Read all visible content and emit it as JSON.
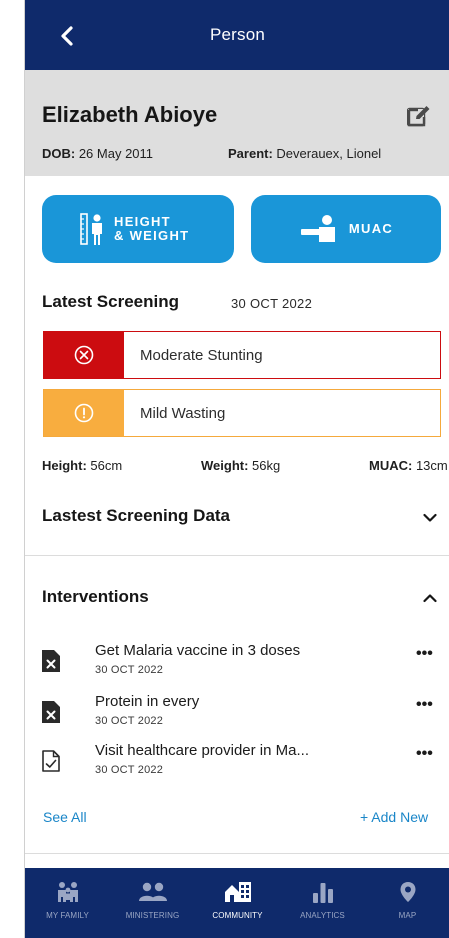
{
  "header": {
    "title": "Person",
    "back_icon": "chevron-left-icon"
  },
  "person": {
    "name": "Elizabeth Abioye",
    "dob_label": "DOB:",
    "dob_value": " 26 May 2011",
    "parent_label": "Parent:",
    "parent_value": " Deverauex, Lionel",
    "edit_icon": "edit-icon"
  },
  "actions": {
    "height_weight_line1": "HEIGHT",
    "height_weight_line2": "& WEIGHT",
    "muac_label": "MUAC"
  },
  "latest_screening": {
    "title": "Latest Screening",
    "date": "30 OCT 2022",
    "statuses": [
      {
        "label": "Moderate Stunting",
        "color": "#cc0c10",
        "icon": "x-circle-icon"
      },
      {
        "label": "Mild Wasting",
        "color": "#f8ad3f",
        "icon": "alert-circle-icon"
      }
    ],
    "height_label": "Height:",
    "height_value": " 56cm",
    "weight_label": "Weight:",
    "weight_value": " 56kg",
    "muac_label": "MUAC:",
    "muac_value": " 13cm"
  },
  "screening_data": {
    "title": "Lastest Screening Data"
  },
  "interventions": {
    "title": "Interventions",
    "items": [
      {
        "title": "Get Malaria vaccine in 3 doses",
        "date": "30 OCT 2022",
        "icon": "file-x-icon"
      },
      {
        "title": "Protein in every",
        "date": "30 OCT 2022",
        "icon": "file-x-icon"
      },
      {
        "title": "Visit healthcare provider in Ma...",
        "date": "30 OCT 2022",
        "icon": "file-check-icon"
      }
    ],
    "more_label": "•••",
    "see_all": "See All",
    "add_new": "+ Add New"
  },
  "nav": {
    "items": [
      {
        "label": "MY FAMILY",
        "icon": "family-icon"
      },
      {
        "label": "MINISTERING",
        "icon": "people-icon"
      },
      {
        "label": "COMMUNITY",
        "icon": "community-icon",
        "active": true
      },
      {
        "label": "ANALYTICS",
        "icon": "bar-chart-icon"
      },
      {
        "label": "MAP",
        "icon": "map-pin-icon"
      }
    ]
  },
  "colors": {
    "primary": "#0f2a6b",
    "accent": "#1a96d8",
    "danger": "#cc0c10",
    "warning": "#f8ad3f",
    "link": "#1a86c8"
  }
}
